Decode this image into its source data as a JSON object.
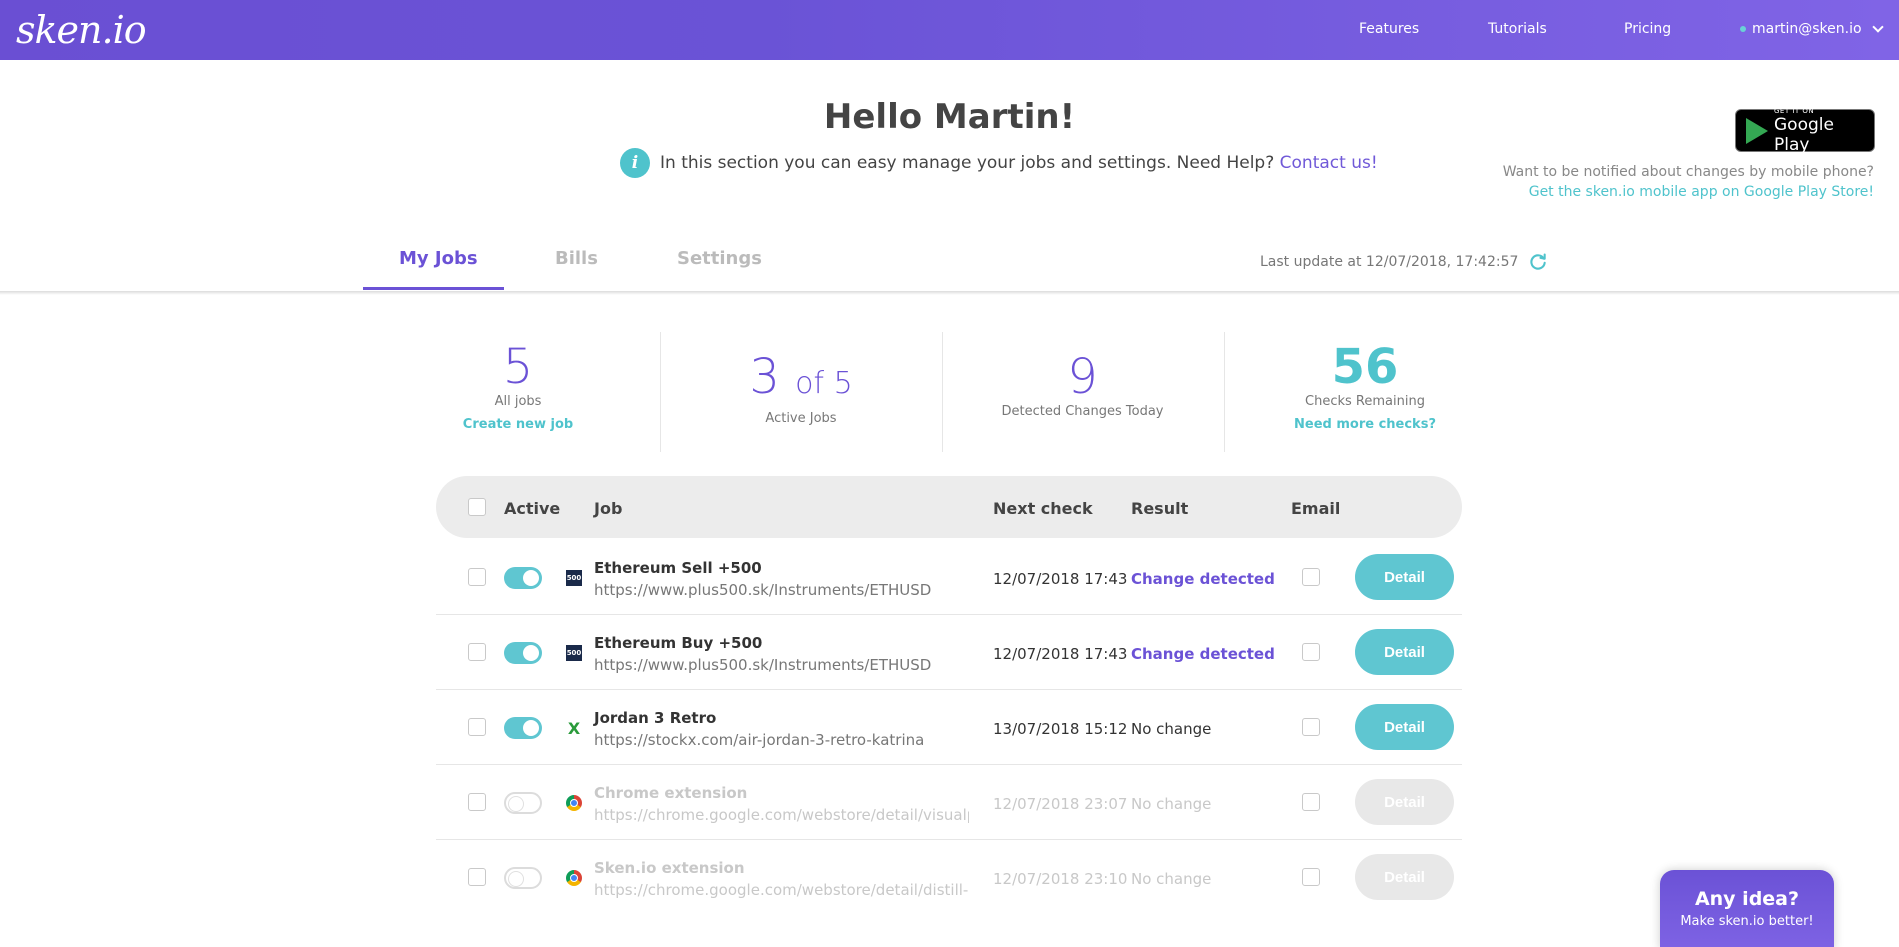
{
  "nav": {
    "logo": "sken.io",
    "features": "Features",
    "tutorials": "Tutorials",
    "pricing": "Pricing",
    "user_email": "martin@sken.io"
  },
  "header": {
    "greeting": "Hello Martin!",
    "intro_text": "In this section you can easy manage your jobs and settings. Need Help?",
    "contact_link": "Contact us!",
    "gplay_small": "GET IT ON",
    "gplay_big": "Google Play",
    "notify_text": "Want to be notified about changes by mobile phone?",
    "notify_link": "Get the sken.io mobile app on Google Play Store!"
  },
  "tabs": {
    "my_jobs": "My Jobs",
    "bills": "Bills",
    "settings": "Settings",
    "active": "My Jobs"
  },
  "last_update": "Last update at 12/07/2018, 17:42:57",
  "stats": {
    "all_jobs": {
      "value": "5",
      "label": "All jobs",
      "link": "Create new job"
    },
    "active_jobs": {
      "value": "3",
      "of": "of 5",
      "label": "Active Jobs"
    },
    "detected": {
      "value": "9",
      "label": "Detected Changes Today"
    },
    "checks": {
      "value": "56",
      "label": "Checks Remaining",
      "link": "Need more checks?"
    }
  },
  "table": {
    "headers": {
      "active": "Active",
      "job": "Job",
      "next_check": "Next check",
      "result": "Result",
      "email": "Email"
    },
    "rows": [
      {
        "title": "Ethereum Sell +500",
        "url": "https://www.plus500.sk/Instruments/ETHUSD",
        "next_check": "12/07/2018 17:43",
        "result": "Change detected",
        "active": true,
        "icon": "plus500-icon",
        "detail": "Detail"
      },
      {
        "title": "Ethereum Buy +500",
        "url": "https://www.plus500.sk/Instruments/ETHUSD",
        "next_check": "12/07/2018 17:43",
        "result": "Change detected",
        "active": true,
        "icon": "plus500-icon",
        "detail": "Detail"
      },
      {
        "title": "Jordan 3 Retro",
        "url": "https://stockx.com/air-jordan-3-retro-katrina",
        "next_check": "13/07/2018 15:12",
        "result": "No change",
        "active": true,
        "icon": "stockx-icon",
        "detail": "Detail"
      },
      {
        "title": "Chrome extension",
        "url": "https://chrome.google.com/webstore/detail/visualpi...",
        "next_check": "12/07/2018 23:07",
        "result": "No change",
        "active": false,
        "icon": "chrome-icon",
        "detail": "Detail"
      },
      {
        "title": "Sken.io extension",
        "url": "https://chrome.google.com/webstore/detail/distill-...",
        "next_check": "12/07/2018 23:10",
        "result": "No change",
        "active": false,
        "icon": "chrome-icon",
        "detail": "Detail"
      }
    ]
  },
  "feedback": {
    "title": "Any idea?",
    "subtitle": "Make sken.io better!"
  },
  "colors": {
    "brand": "#6b52d6",
    "accent": "#4fc3cc"
  }
}
